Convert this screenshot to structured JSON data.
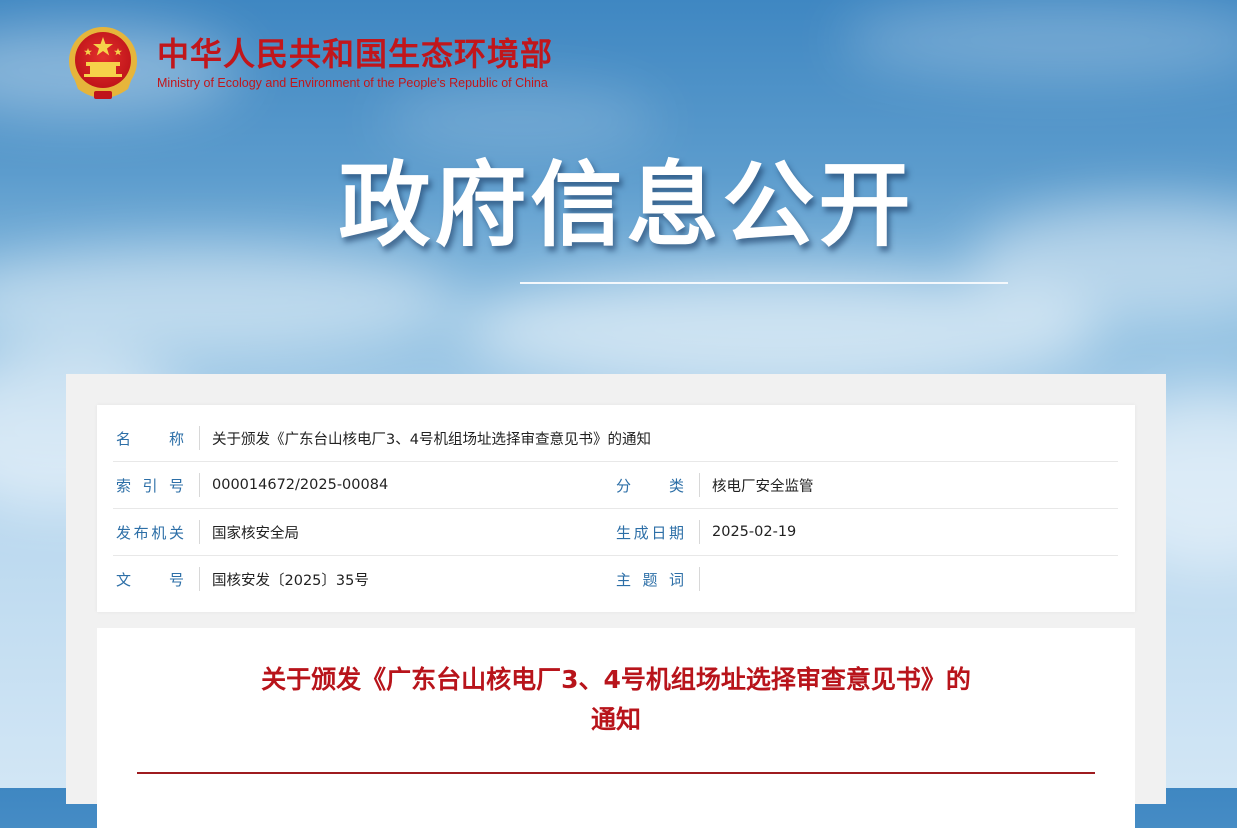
{
  "header": {
    "org_name_cn": "中华人民共和国生态环境部",
    "org_name_en": "Ministry of Ecology and Environment of the People's Republic of China",
    "emblem_icon": "national-emblem-icon"
  },
  "hero": {
    "title": "政府信息公开"
  },
  "info": {
    "name_label": "名称",
    "name_value": "关于颁发《广东台山核电厂3、4号机组场址选择审查意见书》的通知",
    "index_label": "索引号",
    "index_value": "000014672/2025-00084",
    "category_label": "分类",
    "category_value": "核电厂安全监管",
    "issuer_label": "发布机关",
    "issuer_value": "国家核安全局",
    "date_label": "生成日期",
    "date_value": "2025-02-19",
    "docno_label": "文号",
    "docno_value": "国核安发〔2025〕35号",
    "keywords_label": "主题词",
    "keywords_value": ""
  },
  "document": {
    "title_line1": "关于颁发《广东台山核电厂3、4号机组场址选择审查意见书》的",
    "title_line2": "通知"
  },
  "colors": {
    "brand_red": "#c1161b",
    "label_blue": "#2d6fa7",
    "title_red": "#b8141b",
    "rule_red": "#9e1b1f"
  }
}
